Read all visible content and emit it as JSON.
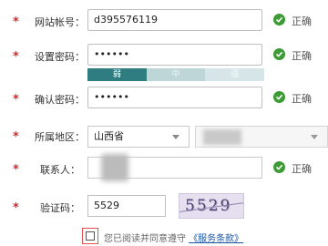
{
  "form": {
    "website_account": {
      "label": "网站帐号：",
      "value": "d395576119",
      "status": "正确"
    },
    "set_password": {
      "label": "设置密码：",
      "value": "••••••",
      "status": "正确"
    },
    "strength": {
      "weak": "弱",
      "medium": "中",
      "strong": "强"
    },
    "confirm_password": {
      "label": "确认密码：",
      "value": "••••••",
      "status": "正确"
    },
    "region": {
      "label": "所属地区：",
      "province": "山西省"
    },
    "contact": {
      "label": "联系人：",
      "status": "正确"
    },
    "captcha": {
      "label": "验证码：",
      "value": "5529",
      "image_text": "5529"
    },
    "agree": {
      "prefix": "您已阅读并同意遵守",
      "link": "《服务条款》"
    }
  },
  "colors": {
    "required_star": "#d9262c",
    "ok_icon": "#3d9b35",
    "strength_weak": "#2f7d80",
    "link": "#1a56a8"
  },
  "icons": {
    "status_ok": "check-circle-icon",
    "dropdown": "chevron-down-icon"
  }
}
